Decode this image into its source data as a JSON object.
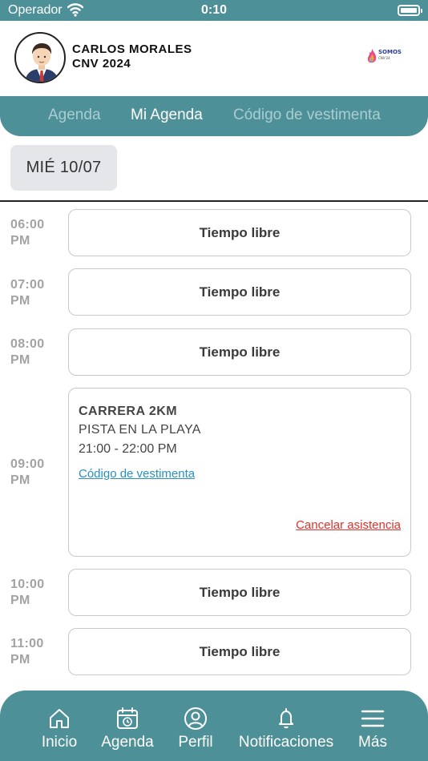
{
  "status_bar": {
    "carrier": "Operador",
    "time": "0:10"
  },
  "user": {
    "name": "CARLOS MORALES",
    "event": "CNV 2024"
  },
  "logo": {
    "text": "SOMOS",
    "sub": "CNV'24"
  },
  "tabs": [
    {
      "label": "Agenda",
      "active": false
    },
    {
      "label": "Mi Agenda",
      "active": true
    },
    {
      "label": "Código de vestimenta",
      "active": false
    }
  ],
  "date_chip": "MIÉ 10/07",
  "schedule": [
    {
      "time": "06:00",
      "period": "PM",
      "slot": "Tiempo libre"
    },
    {
      "time": "07:00",
      "period": "PM",
      "slot": "Tiempo libre"
    },
    {
      "time": "08:00",
      "period": "PM",
      "slot": "Tiempo libre"
    },
    {
      "time": "09:00",
      "period": "PM"
    },
    {
      "time": "10:00",
      "period": "PM",
      "slot": "Tiempo libre"
    },
    {
      "time": "11:00",
      "period": "PM",
      "slot": "Tiempo libre"
    }
  ],
  "event": {
    "title": "CARRERA 2KM",
    "location": "PISTA EN LA PLAYA",
    "time_range": "21:00 - 22:00 PM",
    "dress_code_link": "Código de vestimenta",
    "cancel_link": "Cancelar asistencia"
  },
  "bottom_nav": [
    {
      "label": "Inicio",
      "icon": "home-icon"
    },
    {
      "label": "Agenda",
      "icon": "calendar-icon"
    },
    {
      "label": "Perfil",
      "icon": "profile-icon"
    },
    {
      "label": "Notificaciones",
      "icon": "bell-icon"
    },
    {
      "label": "Más",
      "icon": "menu-icon"
    }
  ],
  "colors": {
    "primary": "#4e9098",
    "tab_inactive": "#a9cdd1",
    "link": "#2a8fc1",
    "cancel": "#e0322b"
  }
}
